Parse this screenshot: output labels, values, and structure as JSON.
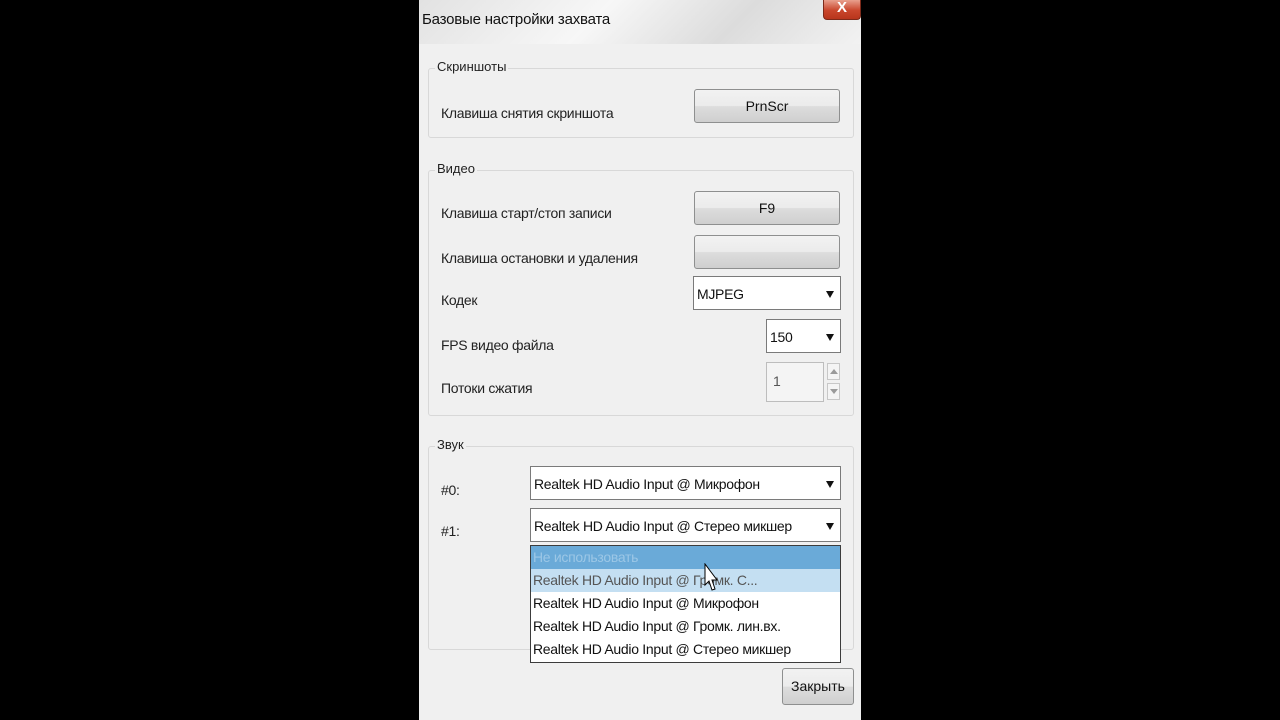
{
  "window": {
    "title": "Базовые настройки захвата",
    "close_label": "X"
  },
  "screenshots": {
    "group_title": "Скриншоты",
    "hotkey_label": "Клавиша снятия скриншота",
    "hotkey_value": "PrnScr"
  },
  "video": {
    "group_title": "Видео",
    "start_stop_label": "Клавиша старт/стоп записи",
    "start_stop_value": "F9",
    "stop_delete_label": "Клавиша остановки и удаления",
    "stop_delete_value": "",
    "codec_label": "Кодек",
    "codec_value": "MJPEG",
    "fps_label": "FPS видео файла",
    "fps_value": "150",
    "threads_label": "Потоки сжатия",
    "threads_value": "1"
  },
  "audio": {
    "group_title": "Звук",
    "dev0_label": "#0:",
    "dev0_value": "Realtek HD Audio Input @ Микрофон",
    "dev1_label": "#1:",
    "dev1_value": "Realtek HD Audio Input @ Стерео микшер",
    "dropdown_options": [
      "Не использовать",
      "Realtek HD Audio Input @ Громк. С...",
      "Realtek HD Audio Input @ Микрофон",
      "Realtek HD Audio Input @ Громк. лин.вх.",
      "Realtek HD Audio Input @ Стерео микшер"
    ]
  },
  "footer": {
    "close_button": "Закрыть"
  }
}
